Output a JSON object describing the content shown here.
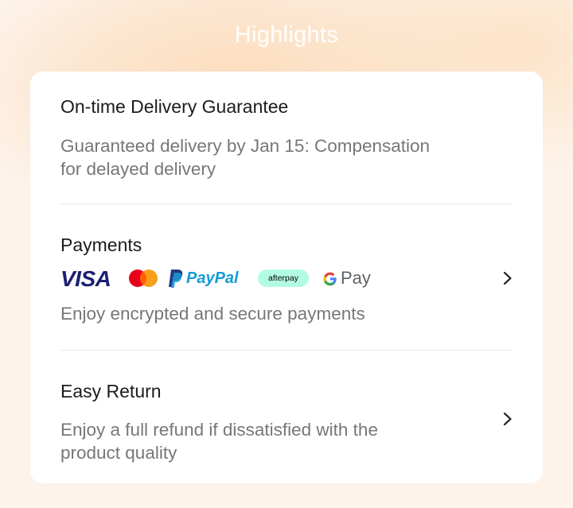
{
  "header": {
    "title": "Highlights"
  },
  "sections": [
    {
      "title": "On-time Delivery Guarantee",
      "description_lines": [
        "Guaranteed delivery by Jan 15: Compensation",
        "for delayed delivery"
      ]
    },
    {
      "title": "Payments",
      "payment_methods": [
        {
          "name": "VISA",
          "icon": "visa-logo"
        },
        {
          "name": "Mastercard",
          "icon": "mastercard-logo"
        },
        {
          "name": "PayPal",
          "icon": "paypal-logo"
        },
        {
          "name": "afterpay",
          "icon": "afterpay-logo"
        },
        {
          "name": "Pay",
          "icon": "google-pay-logo"
        }
      ],
      "description_lines": [
        "Enjoy encrypted and secure payments"
      ]
    },
    {
      "title": "Easy Return",
      "description_lines": [
        "Enjoy a full refund if dissatisfied with the",
        "product quality"
      ]
    }
  ],
  "colors": {
    "visa_blue": "#1a1f71",
    "mastercard_red": "#eb001b",
    "mastercard_orange": "#f79e1b",
    "paypal_dark": "#253b80",
    "paypal_light": "#179bd7",
    "afterpay_mint": "#b2fce4",
    "google_gray": "#5f6368"
  }
}
